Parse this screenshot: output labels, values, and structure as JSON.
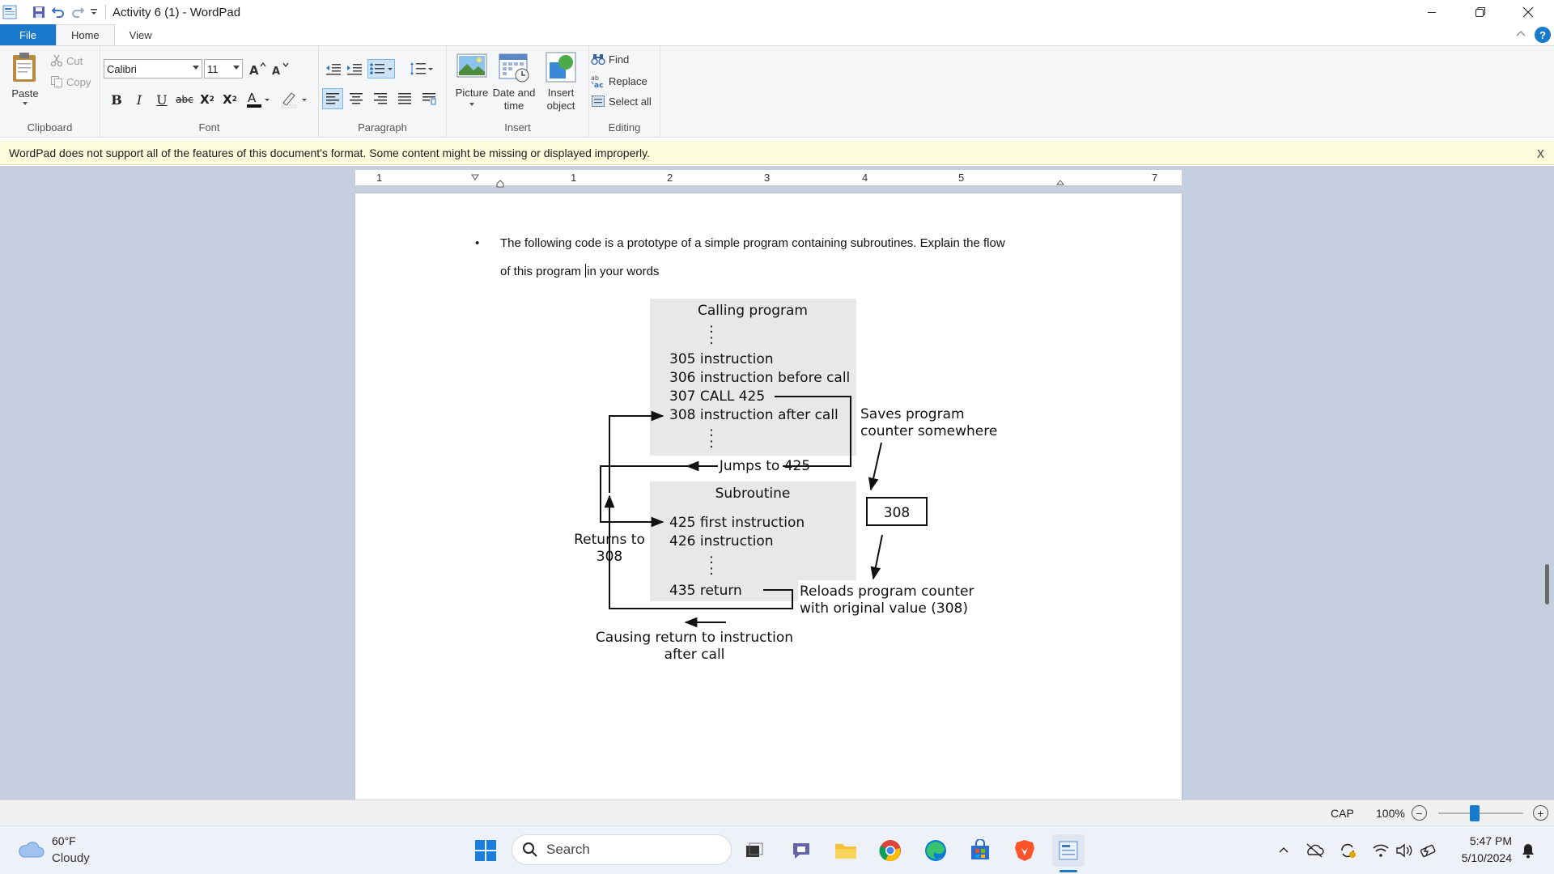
{
  "window": {
    "title": "Activity 6 (1) - WordPad"
  },
  "tabs": [
    "File",
    "Home",
    "View"
  ],
  "clipboard": {
    "paste": "Paste",
    "cut": "Cut",
    "copy": "Copy",
    "group_label": "Clipboard"
  },
  "font": {
    "family": "Calibri",
    "size": "11",
    "group_label": "Font"
  },
  "paragraph": {
    "group_label": "Paragraph"
  },
  "insert": {
    "picture": "Picture",
    "datetime_line1": "Date and",
    "datetime_line2": "time",
    "object_line1": "Insert",
    "object_line2": "object",
    "group_label": "Insert"
  },
  "editing": {
    "find": "Find",
    "replace": "Replace",
    "select_all": "Select all",
    "group_label": "Editing"
  },
  "notice": {
    "text": "WordPad does not support all of the features of this document's format. Some content might be missing or displayed improperly.",
    "close": "x"
  },
  "ruler": {
    "numbers": [
      "1",
      "1",
      "2",
      "3",
      "4",
      "5",
      "7"
    ]
  },
  "document": {
    "bullet": "•",
    "line1": "The following code is a prototype of a simple program containing subroutines. Explain the flow",
    "line2_before_caret": "of this program ",
    "line2_after_caret": "in your words"
  },
  "diagram": {
    "calling_program": "Calling program",
    "l305": "305 instruction",
    "l306": "306 instruction before call",
    "l307": "307 CALL 425",
    "l308": "308 instruction after call",
    "saves_line1": "Saves program",
    "saves_line2": "counter somewhere",
    "jumps": "Jumps to 425",
    "subroutine": "Subroutine",
    "box_value": "308",
    "l425": "425 first instruction",
    "l426": "426 instruction",
    "returns_line1": "Returns to",
    "returns_line2": "308",
    "l435": "435 return",
    "reloads_line1": "Reloads program counter",
    "reloads_line2": "with original value (308)",
    "causing_line1": "Causing return to instruction",
    "causing_line2": "after call",
    "dots": ":"
  },
  "status": {
    "caps": "CAP",
    "zoom": "100%",
    "zoom_fraction": 0.43
  },
  "taskbar": {
    "temperature": "60°F",
    "weather": "Cloudy",
    "search": "Search",
    "time": "5:47 PM",
    "date": "5/10/2024"
  },
  "colors": {
    "accent": "#1979ca",
    "diagram_fill": "#e8e8e8",
    "workspace": "#c6cfe0",
    "notice": "#fcfbdb"
  }
}
